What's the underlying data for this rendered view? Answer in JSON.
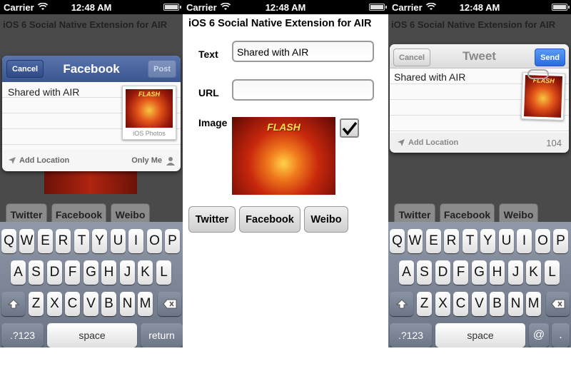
{
  "status_bar": {
    "carrier": "Carrier",
    "time": "12:48 AM"
  },
  "app": {
    "title": "iOS 6 Social Native Extension for AIR",
    "text_label": "Text",
    "text_value": "Shared with AIR",
    "url_label": "URL",
    "url_value": "",
    "image_label": "Image",
    "image_caption": "FLASH",
    "image_checked": true,
    "buttons": [
      "Twitter",
      "Facebook",
      "Weibo"
    ]
  },
  "facebook_sheet": {
    "title": "Facebook",
    "cancel": "Cancel",
    "post": "Post",
    "text": "Shared with AIR",
    "photo_caption": "iOS Photos",
    "add_location": "Add Location",
    "audience": "Only Me",
    "thumb_caption": "FLASH"
  },
  "tweet_sheet": {
    "title": "Tweet",
    "cancel": "Cancel",
    "send": "Send",
    "text": "Shared with AIR",
    "add_location": "Add Location",
    "char_count": "104",
    "thumb_caption": "FLASH"
  },
  "background_app": {
    "title": "iOS 6 Social Native Extension for AIR",
    "buttons": [
      "Twitter",
      "Facebook",
      "Weibo"
    ]
  },
  "keyboard": {
    "row1": [
      "Q",
      "W",
      "E",
      "R",
      "T",
      "Y",
      "U",
      "I",
      "O",
      "P"
    ],
    "row2": [
      "A",
      "S",
      "D",
      "F",
      "G",
      "H",
      "J",
      "K",
      "L"
    ],
    "row3": [
      "Z",
      "X",
      "C",
      "V",
      "B",
      "N",
      "M"
    ],
    "numbers": ".?123",
    "space": "space",
    "return": "return",
    "at": "@",
    "dot": "."
  },
  "colors": {
    "facebook_blue": "#3b5591",
    "send_blue": "#2a6ae0",
    "keyboard": "#7a8394"
  }
}
